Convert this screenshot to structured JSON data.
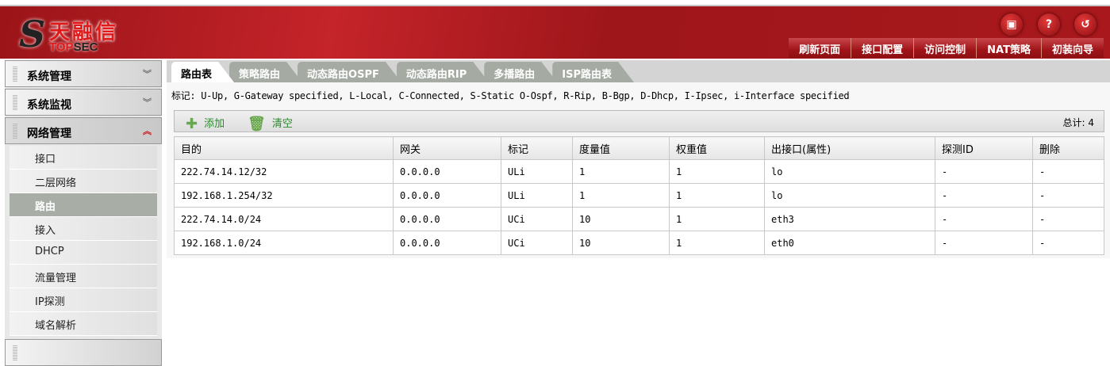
{
  "header": {
    "logo_cn": "天融信",
    "logo_en_red": "TOP",
    "logo_en_dark": "SEC",
    "icons": [
      "save-icon",
      "help-icon",
      "logout-icon"
    ],
    "nav": [
      "刷新页面",
      "接口配置",
      "访问控制",
      "NAT策略",
      "初装向导"
    ]
  },
  "sidebar": {
    "groups": [
      {
        "label": "系统管理",
        "open": false
      },
      {
        "label": "系统监视",
        "open": false
      },
      {
        "label": "网络管理",
        "open": true
      }
    ],
    "items": [
      "接口",
      "二层网络",
      "路由",
      "接入",
      "DHCP",
      "流量管理",
      "IP探测",
      "域名解析"
    ],
    "active": "路由"
  },
  "tabs": [
    "路由表",
    "策略路由",
    "动态路由OSPF",
    "动态路由RIP",
    "多播路由",
    "ISP路由表"
  ],
  "legend": "标记: U-Up, G-Gateway specified, L-Local, C-Connected, S-Static O-Ospf, R-Rip, B-Bgp, D-Dhcp, I-Ipsec, i-Interface specified",
  "toolbar": {
    "add": "添加",
    "clear": "清空",
    "total": "总计: 4"
  },
  "table": {
    "headers": [
      "目的",
      "网关",
      "标记",
      "度量值",
      "权重值",
      "出接口(属性)",
      "探测ID",
      "删除"
    ],
    "rows": [
      [
        "222.74.14.12/32",
        "0.0.0.0",
        "ULi",
        "1",
        "1",
        "lo",
        "-",
        "-"
      ],
      [
        "192.168.1.254/32",
        "0.0.0.0",
        "ULi",
        "1",
        "1",
        "lo",
        "-",
        "-"
      ],
      [
        "222.74.14.0/24",
        "0.0.0.0",
        "UCi",
        "10",
        "1",
        "eth3",
        "-",
        "-"
      ],
      [
        "192.168.1.0/24",
        "0.0.0.0",
        "UCi",
        "10",
        "1",
        "eth0",
        "-",
        "-"
      ]
    ]
  }
}
